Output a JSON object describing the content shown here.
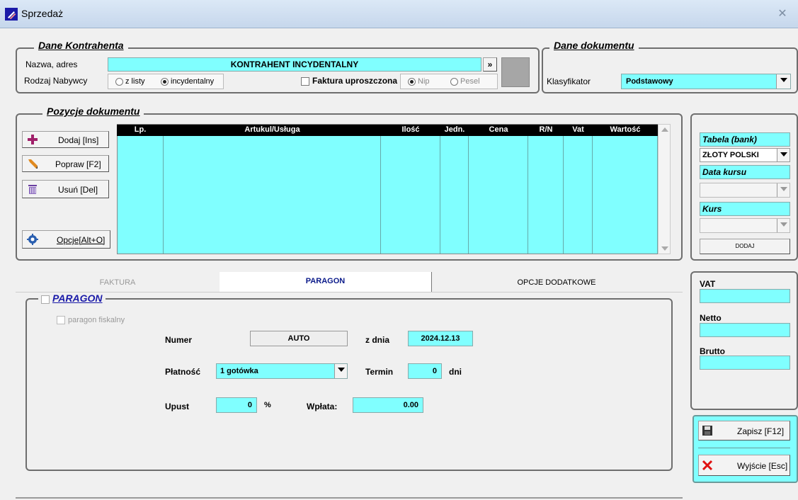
{
  "window": {
    "title": "Sprzedaż",
    "close_glyph": "✕"
  },
  "kontrahent": {
    "legend": "Dane Kontrahenta",
    "name_label": "Nazwa, adres",
    "name_value": "KONTRAHENT INCYDENTALNY",
    "more_button": "»",
    "buyer_type_label": "Rodzaj Nabywcy",
    "buyer_options": [
      {
        "label": "z listy",
        "selected": false
      },
      {
        "label": "incydentalny",
        "selected": true
      }
    ],
    "simplified_invoice_label": "Faktura uproszczona",
    "id_options": [
      {
        "label": "Nip",
        "selected": true
      },
      {
        "label": "Pesel",
        "selected": false
      }
    ]
  },
  "dokument": {
    "legend": "Dane dokumentu",
    "classifier_label": "Klasyfikator",
    "classifier_value": "Podstawowy"
  },
  "pozycje": {
    "legend": "Pozycje dokumentu",
    "buttons": [
      {
        "label": "Dodaj  [Ins]",
        "icon": "plus-icon"
      },
      {
        "label": "Popraw  [F2]",
        "icon": "pencil-icon"
      },
      {
        "label": "Usuń  [Del]",
        "icon": "trash-icon"
      },
      {
        "label": "Opcje[Alt+O]",
        "icon": "gear-icon"
      }
    ],
    "columns": [
      "Lp.",
      "Artukul/Usługa",
      "Ilość",
      "Jedn.",
      "Cena",
      "R/N",
      "Vat",
      "Wartość"
    ]
  },
  "currency": {
    "table_label": "Tabela (bank)",
    "table_value": "ZŁOTY POLSKI",
    "rate_date_label": "Data kursu",
    "rate_label": "Kurs",
    "add_button": "DODAJ"
  },
  "tabs": [
    {
      "label": "FAKTURA",
      "active": false
    },
    {
      "label": "PARAGON",
      "active": true
    },
    {
      "label": "OPCJE DODATKOWE",
      "active": false
    }
  ],
  "paragon": {
    "legend": "PARAGON",
    "fiscal_label": "paragon fiskalny",
    "numer_label": "Numer",
    "numer_value": "AUTO",
    "date_label": "z dnia",
    "date_value": "2024.12.13",
    "payment_label": "Płatność",
    "payment_value": "1 gotówka",
    "term_label": "Termin",
    "term_value": "0",
    "term_unit": "dni",
    "discount_label": "Upust",
    "discount_value": "0",
    "discount_unit": "%",
    "deposit_label": "Wpłata:",
    "deposit_value": "0.00"
  },
  "totals": {
    "vat_label": "VAT",
    "netto_label": "Netto",
    "brutto_label": "Brutto"
  },
  "actions": {
    "save_label": "Zapisz  [F12]",
    "exit_label": "Wyjście  [Esc]"
  },
  "colors": {
    "field": "#80ffff",
    "accent_blue": "#1a1aa8"
  }
}
